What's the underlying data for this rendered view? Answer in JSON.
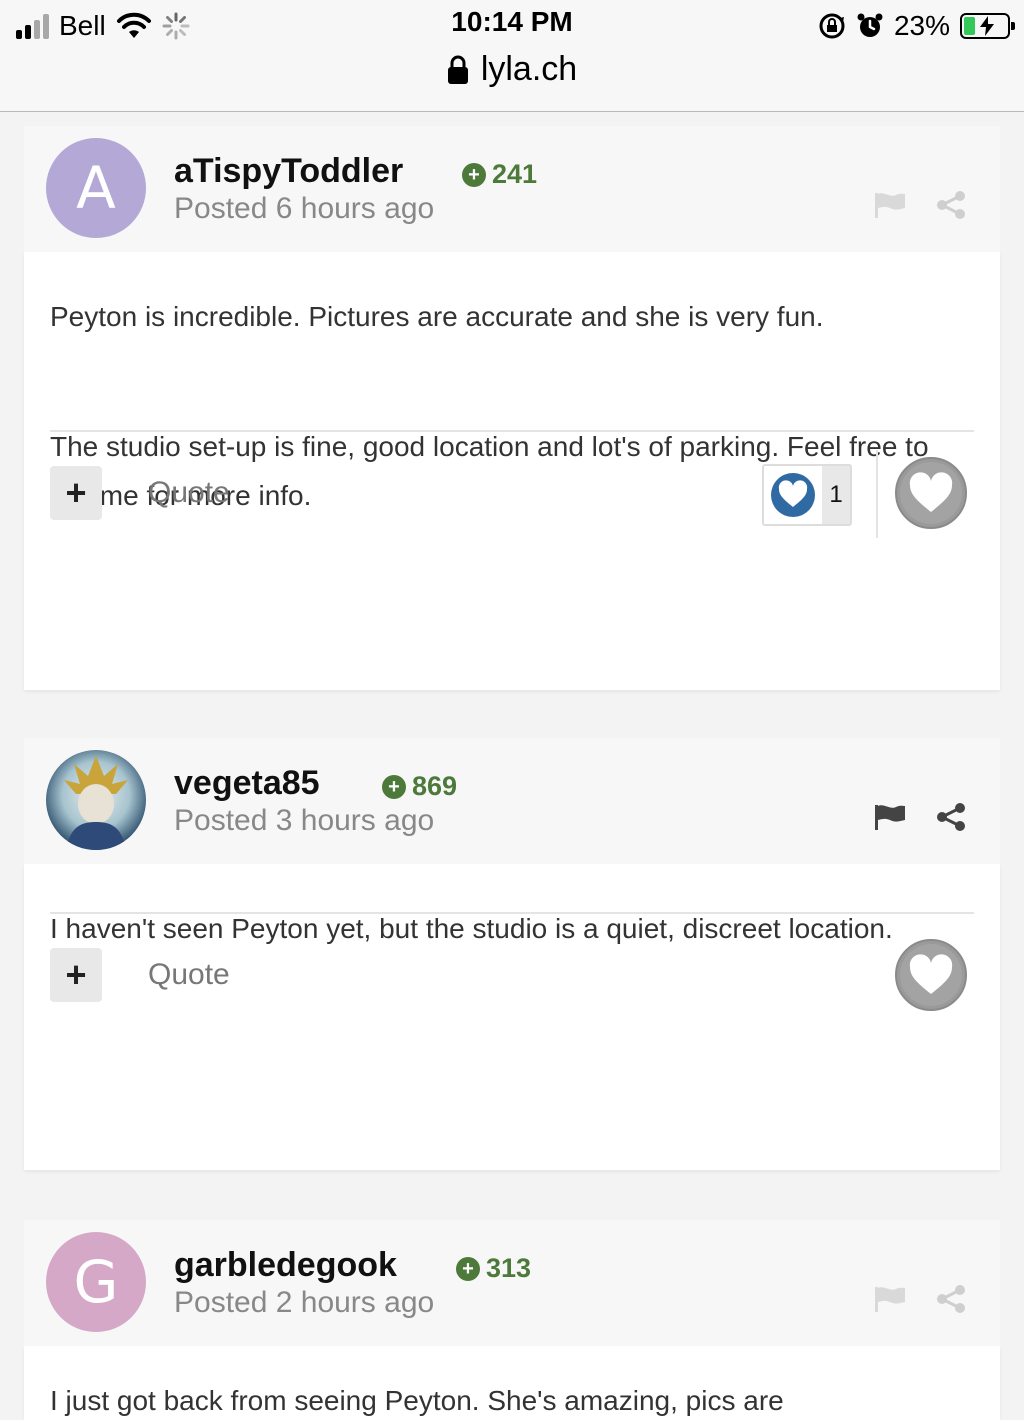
{
  "status_bar": {
    "carrier": "Bell",
    "time": "10:14 PM",
    "battery_percent": "23%",
    "battery_level": 0.23,
    "icons": [
      "signal-icon",
      "wifi-icon",
      "loading-spinner-icon",
      "rotation-lock-icon",
      "alarm-icon",
      "battery-charging-icon"
    ]
  },
  "browser": {
    "url": "lyla.ch",
    "lock_icon": "lock-icon"
  },
  "colors": {
    "reputation_green": "#4d7a3a",
    "avatar_purple": "#b4a8d6",
    "avatar_pink": "#d6a8c7",
    "reaction_blue": "#2f6aa3",
    "like_gray": "#9a9a9a"
  },
  "posts": [
    {
      "username": "aTispyToddler",
      "avatar_letter": "A",
      "reputation": "241",
      "posted": "Posted 6 hours ago",
      "paragraphs": [
        "Peyton is incredible. Pictures are accurate and she is very fun.",
        "The studio set-up is fine, good location and lot's of parking. Feel free to Pm me for more info."
      ],
      "quote_label": "Quote",
      "reaction_count": "1"
    },
    {
      "username": "vegeta85",
      "reputation": "869",
      "posted": "Posted 3 hours ago",
      "paragraphs": [
        "I haven't seen Peyton yet, but the studio is a quiet, discreet location."
      ],
      "quote_label": "Quote"
    },
    {
      "username": "garbledegook",
      "avatar_letter": "G",
      "reputation": "313",
      "posted": "Posted 2 hours ago",
      "paragraphs": [
        "I just got back from seeing Peyton. She's amazing, pics are"
      ]
    }
  ]
}
